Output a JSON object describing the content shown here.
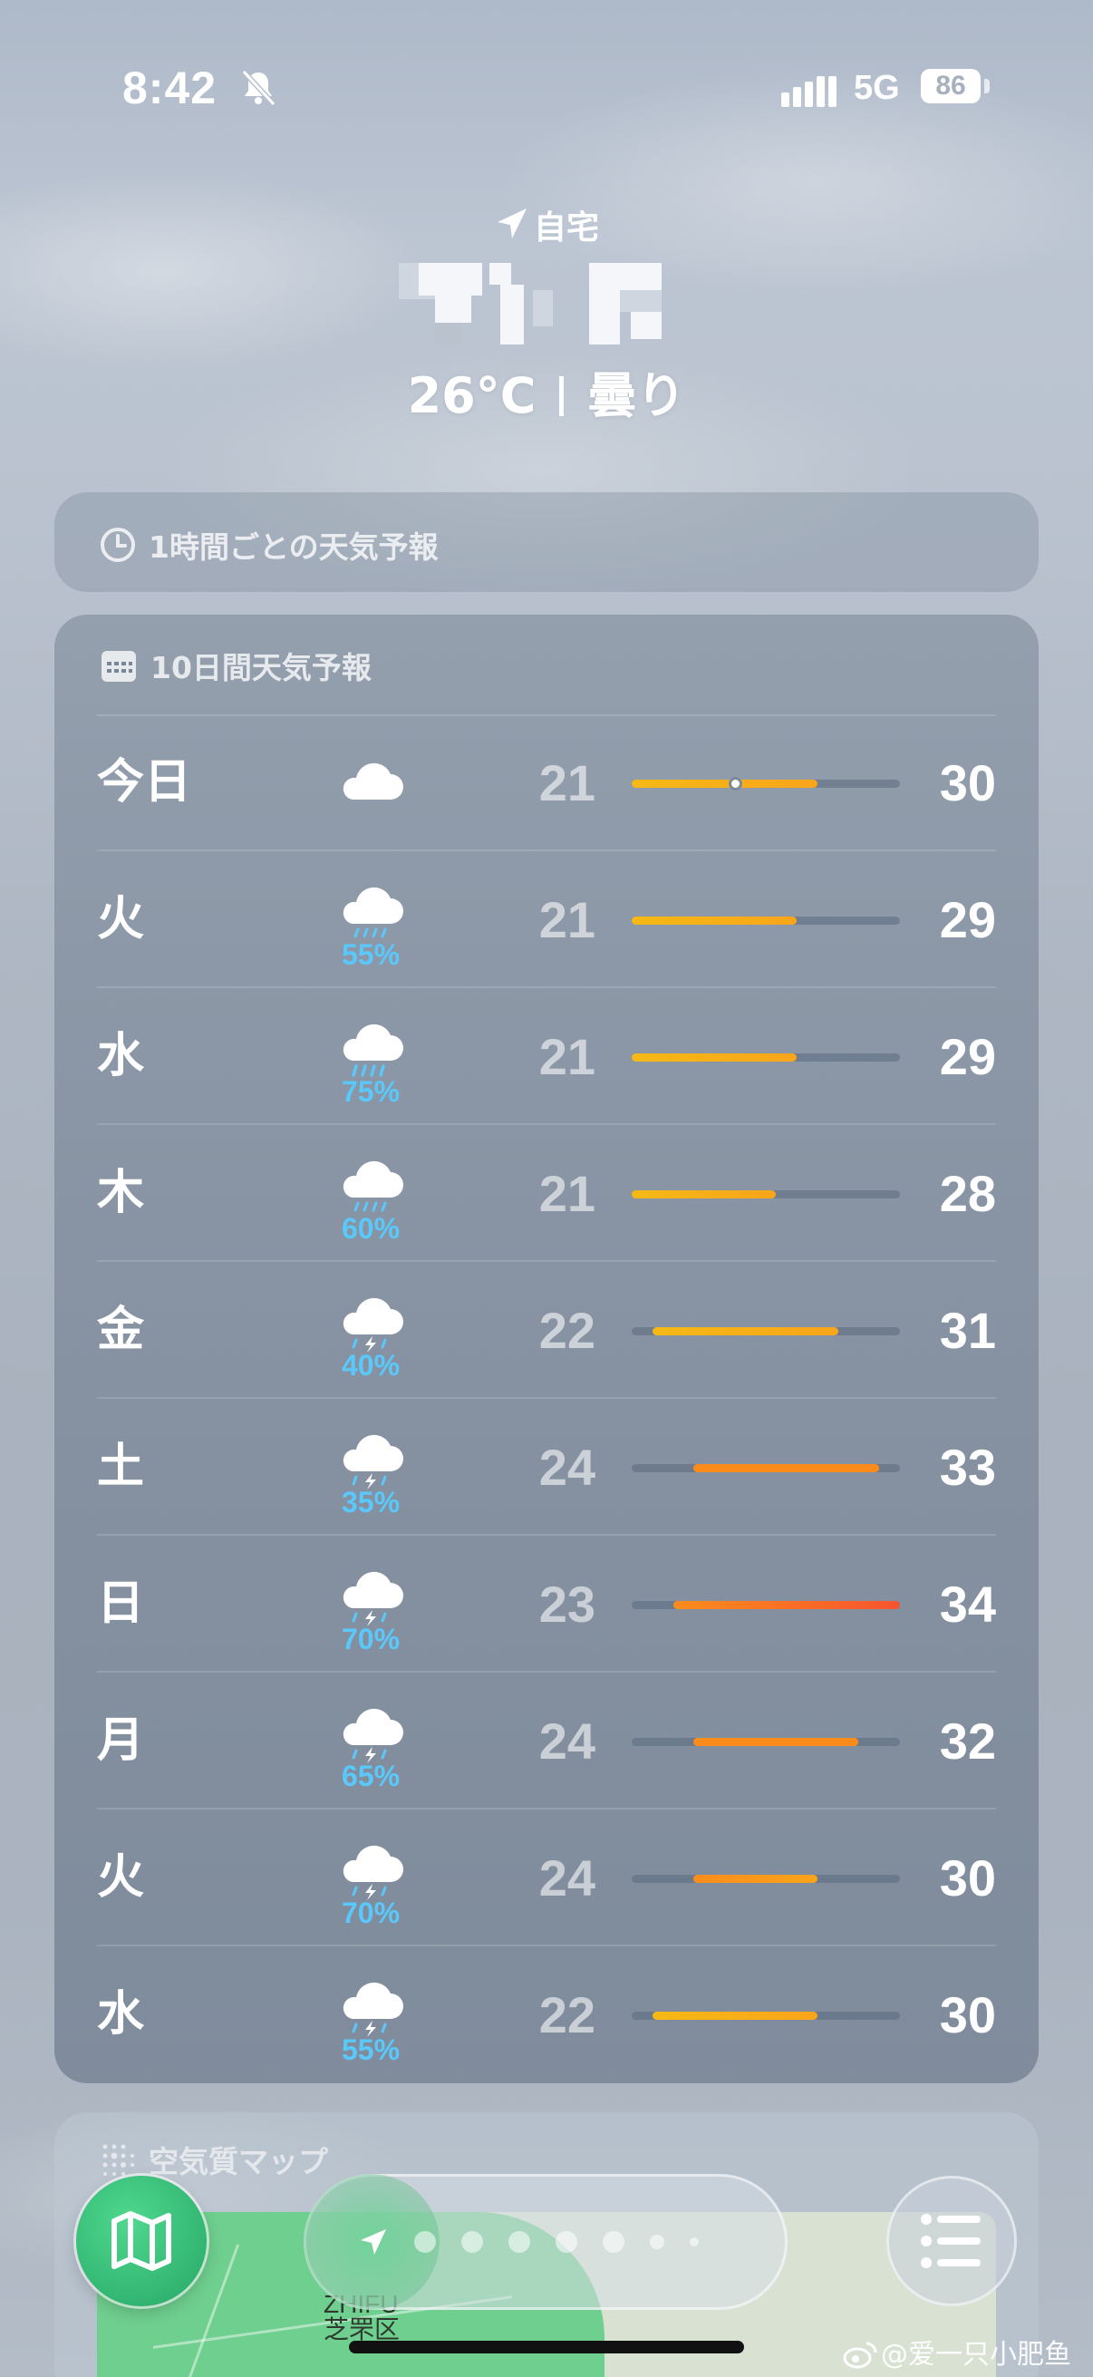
{
  "status_bar": {
    "time": "8:42",
    "network": "5G",
    "battery": "86"
  },
  "header": {
    "location_label": "自宅",
    "current_temp": "26°C",
    "condition": "曇り"
  },
  "hourly": {
    "title": "1時間ごとの天気予報"
  },
  "daily": {
    "title": "10日間天気予報",
    "range_min": 21,
    "range_max": 34,
    "days": [
      {
        "name": "今日",
        "icon": "cloud-icon",
        "precip": "",
        "low": "21",
        "high": "30",
        "current": 26
      },
      {
        "name": "火",
        "icon": "cloud-drizzle-icon",
        "precip": "55%",
        "low": "21",
        "high": "29"
      },
      {
        "name": "水",
        "icon": "cloud-rain-icon",
        "precip": "75%",
        "low": "21",
        "high": "29"
      },
      {
        "name": "木",
        "icon": "cloud-drizzle-icon",
        "precip": "60%",
        "low": "21",
        "high": "28"
      },
      {
        "name": "金",
        "icon": "cloud-bolt-rain-icon",
        "precip": "40%",
        "low": "22",
        "high": "31"
      },
      {
        "name": "土",
        "icon": "cloud-bolt-rain-icon",
        "precip": "35%",
        "low": "24",
        "high": "33"
      },
      {
        "name": "日",
        "icon": "cloud-bolt-rain-icon",
        "precip": "70%",
        "low": "23",
        "high": "34"
      },
      {
        "name": "月",
        "icon": "cloud-bolt-rain-icon",
        "precip": "65%",
        "low": "24",
        "high": "32"
      },
      {
        "name": "火",
        "icon": "cloud-bolt-rain-icon",
        "precip": "70%",
        "low": "24",
        "high": "30"
      },
      {
        "name": "水",
        "icon": "cloud-bolt-rain-icon",
        "precip": "55%",
        "low": "22",
        "high": "30"
      }
    ]
  },
  "air_quality": {
    "title": "空気質マップ",
    "map_label_en": "ZHIFU",
    "map_label_zh": "芝罘区"
  },
  "toolbar": {
    "page_count": 7
  },
  "watermark": "@爱一只小肥鱼",
  "colors": {
    "precip": "#5ac8fa",
    "temp_cool": "#f5b915",
    "temp_warm": "#fb8c1c",
    "temp_hot": "#f7542e",
    "map_button": "#2fbf74"
  }
}
